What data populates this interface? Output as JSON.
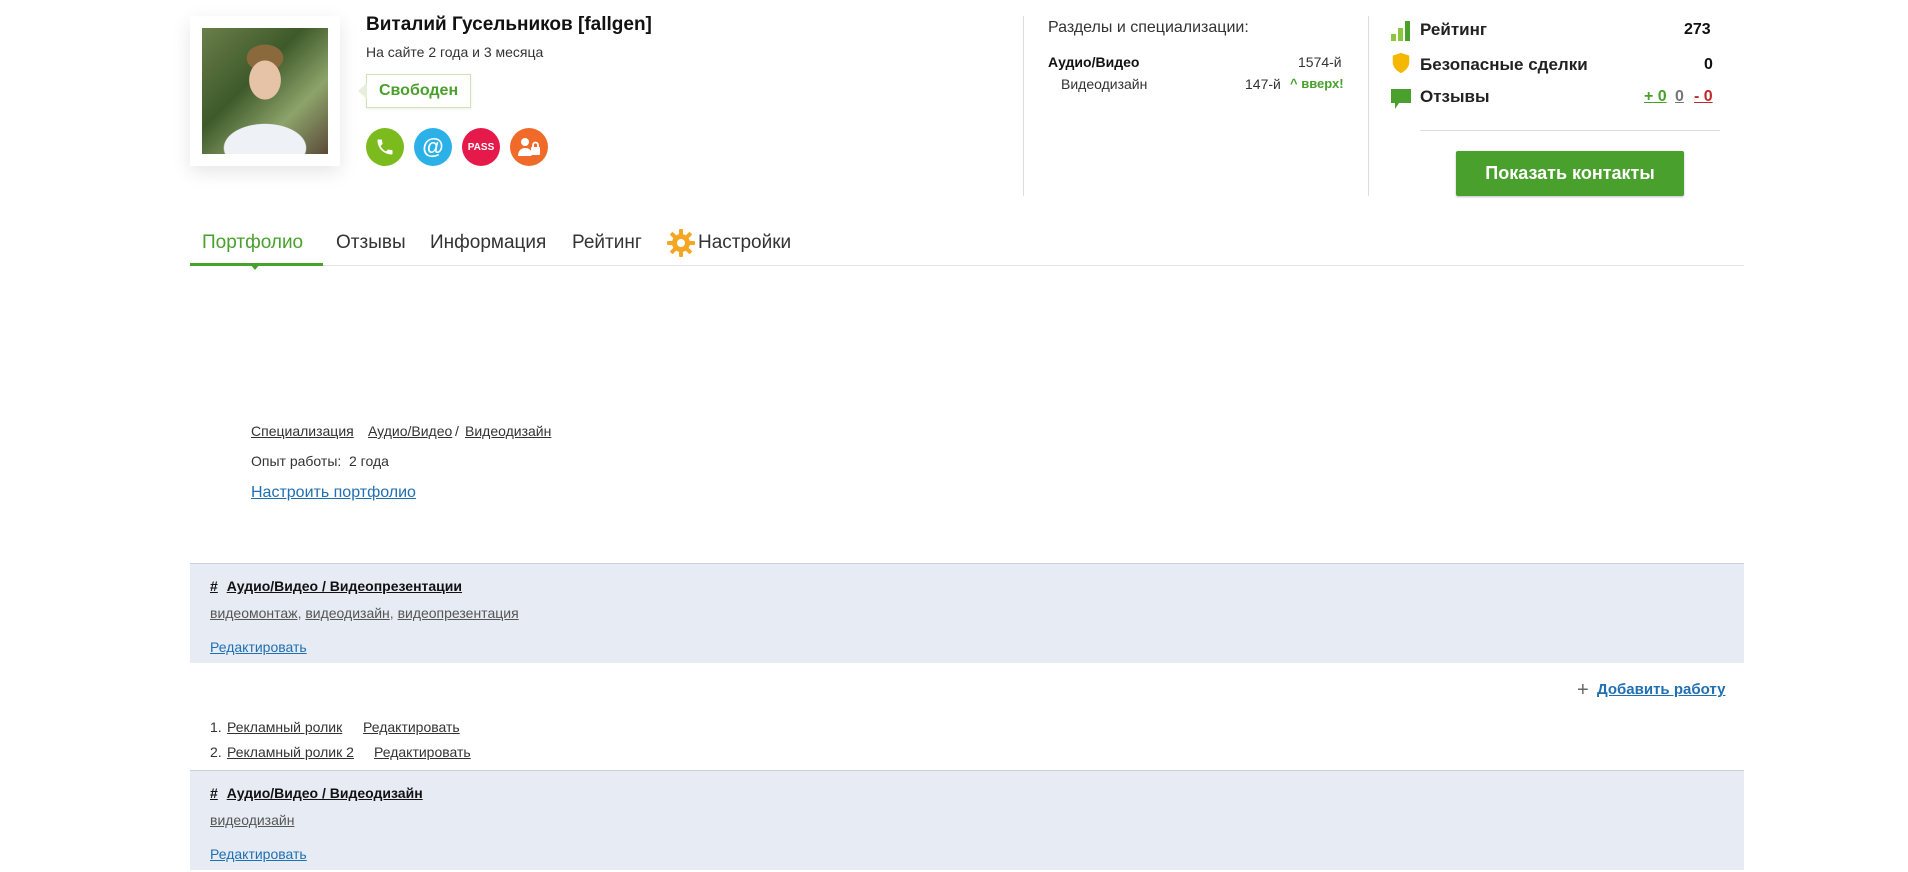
{
  "profile": {
    "name": "Виталий Гусельников [fallgen]",
    "on_site": "На сайте 2 года и 3 месяца",
    "status": "Свободен"
  },
  "verification_icons": [
    {
      "icon": "phone-icon",
      "glyph": "✆"
    },
    {
      "icon": "email-icon",
      "glyph": "@"
    },
    {
      "icon": "pass-icon",
      "glyph": "PASS"
    },
    {
      "icon": "safe-deal-icon",
      "glyph": ""
    }
  ],
  "sections": {
    "title": "Разделы и специализации:",
    "main_name": "Аудио/Видео",
    "main_rank": "1574-й",
    "sub_name": "Видеодизайн",
    "sub_rank": "147-й",
    "sub_trend": "^ вверх!"
  },
  "stats": {
    "rating_label": "Рейтинг",
    "rating_value": "273",
    "deals_label": "Безопасные сделки",
    "deals_value": "0",
    "reviews_label": "Отзывы",
    "reviews_positive": "+ 0",
    "reviews_neutral": "0",
    "reviews_negative": "- 0",
    "show_contacts": "Показать контакты",
    "colors": {
      "accent": "#4aa02c",
      "negative": "#c0282d",
      "shield": "#f5b800"
    }
  },
  "tabs": [
    {
      "label": "Портфолио",
      "active": true
    },
    {
      "label": "Отзывы"
    },
    {
      "label": "Информация"
    },
    {
      "label": "Рейтинг"
    },
    {
      "label": "Настройки",
      "icon": "gear-icon"
    }
  ],
  "portfolio": {
    "spec_label": "Специализация",
    "spec_colon": ":",
    "spec_value_1": "Аудио/Видео",
    "spec_slash": "/",
    "spec_value_2": "Видеодизайн",
    "exp_label": "Опыт работы:",
    "exp_value": "2 года",
    "configure_link": "Настроить портфолио",
    "add_work": "Добавить работу",
    "categories": [
      {
        "hash": "#",
        "title": "Аудио/Видео / Видеопрезентации",
        "tags": [
          "видеомонтаж",
          "видеодизайн",
          "видеопрезентация"
        ],
        "tag_sep": ",",
        "edit": "Редактировать"
      },
      {
        "hash": "#",
        "title": "Аудио/Видео / Видеодизайн",
        "tags": [
          "видеодизайн"
        ],
        "edit": "Редактировать"
      }
    ],
    "works": [
      {
        "num": "1.",
        "title": "Рекламный ролик",
        "edit": "Редактировать"
      },
      {
        "num": "2.",
        "title": "Рекламный ролик 2",
        "edit": "Редактировать"
      }
    ]
  }
}
